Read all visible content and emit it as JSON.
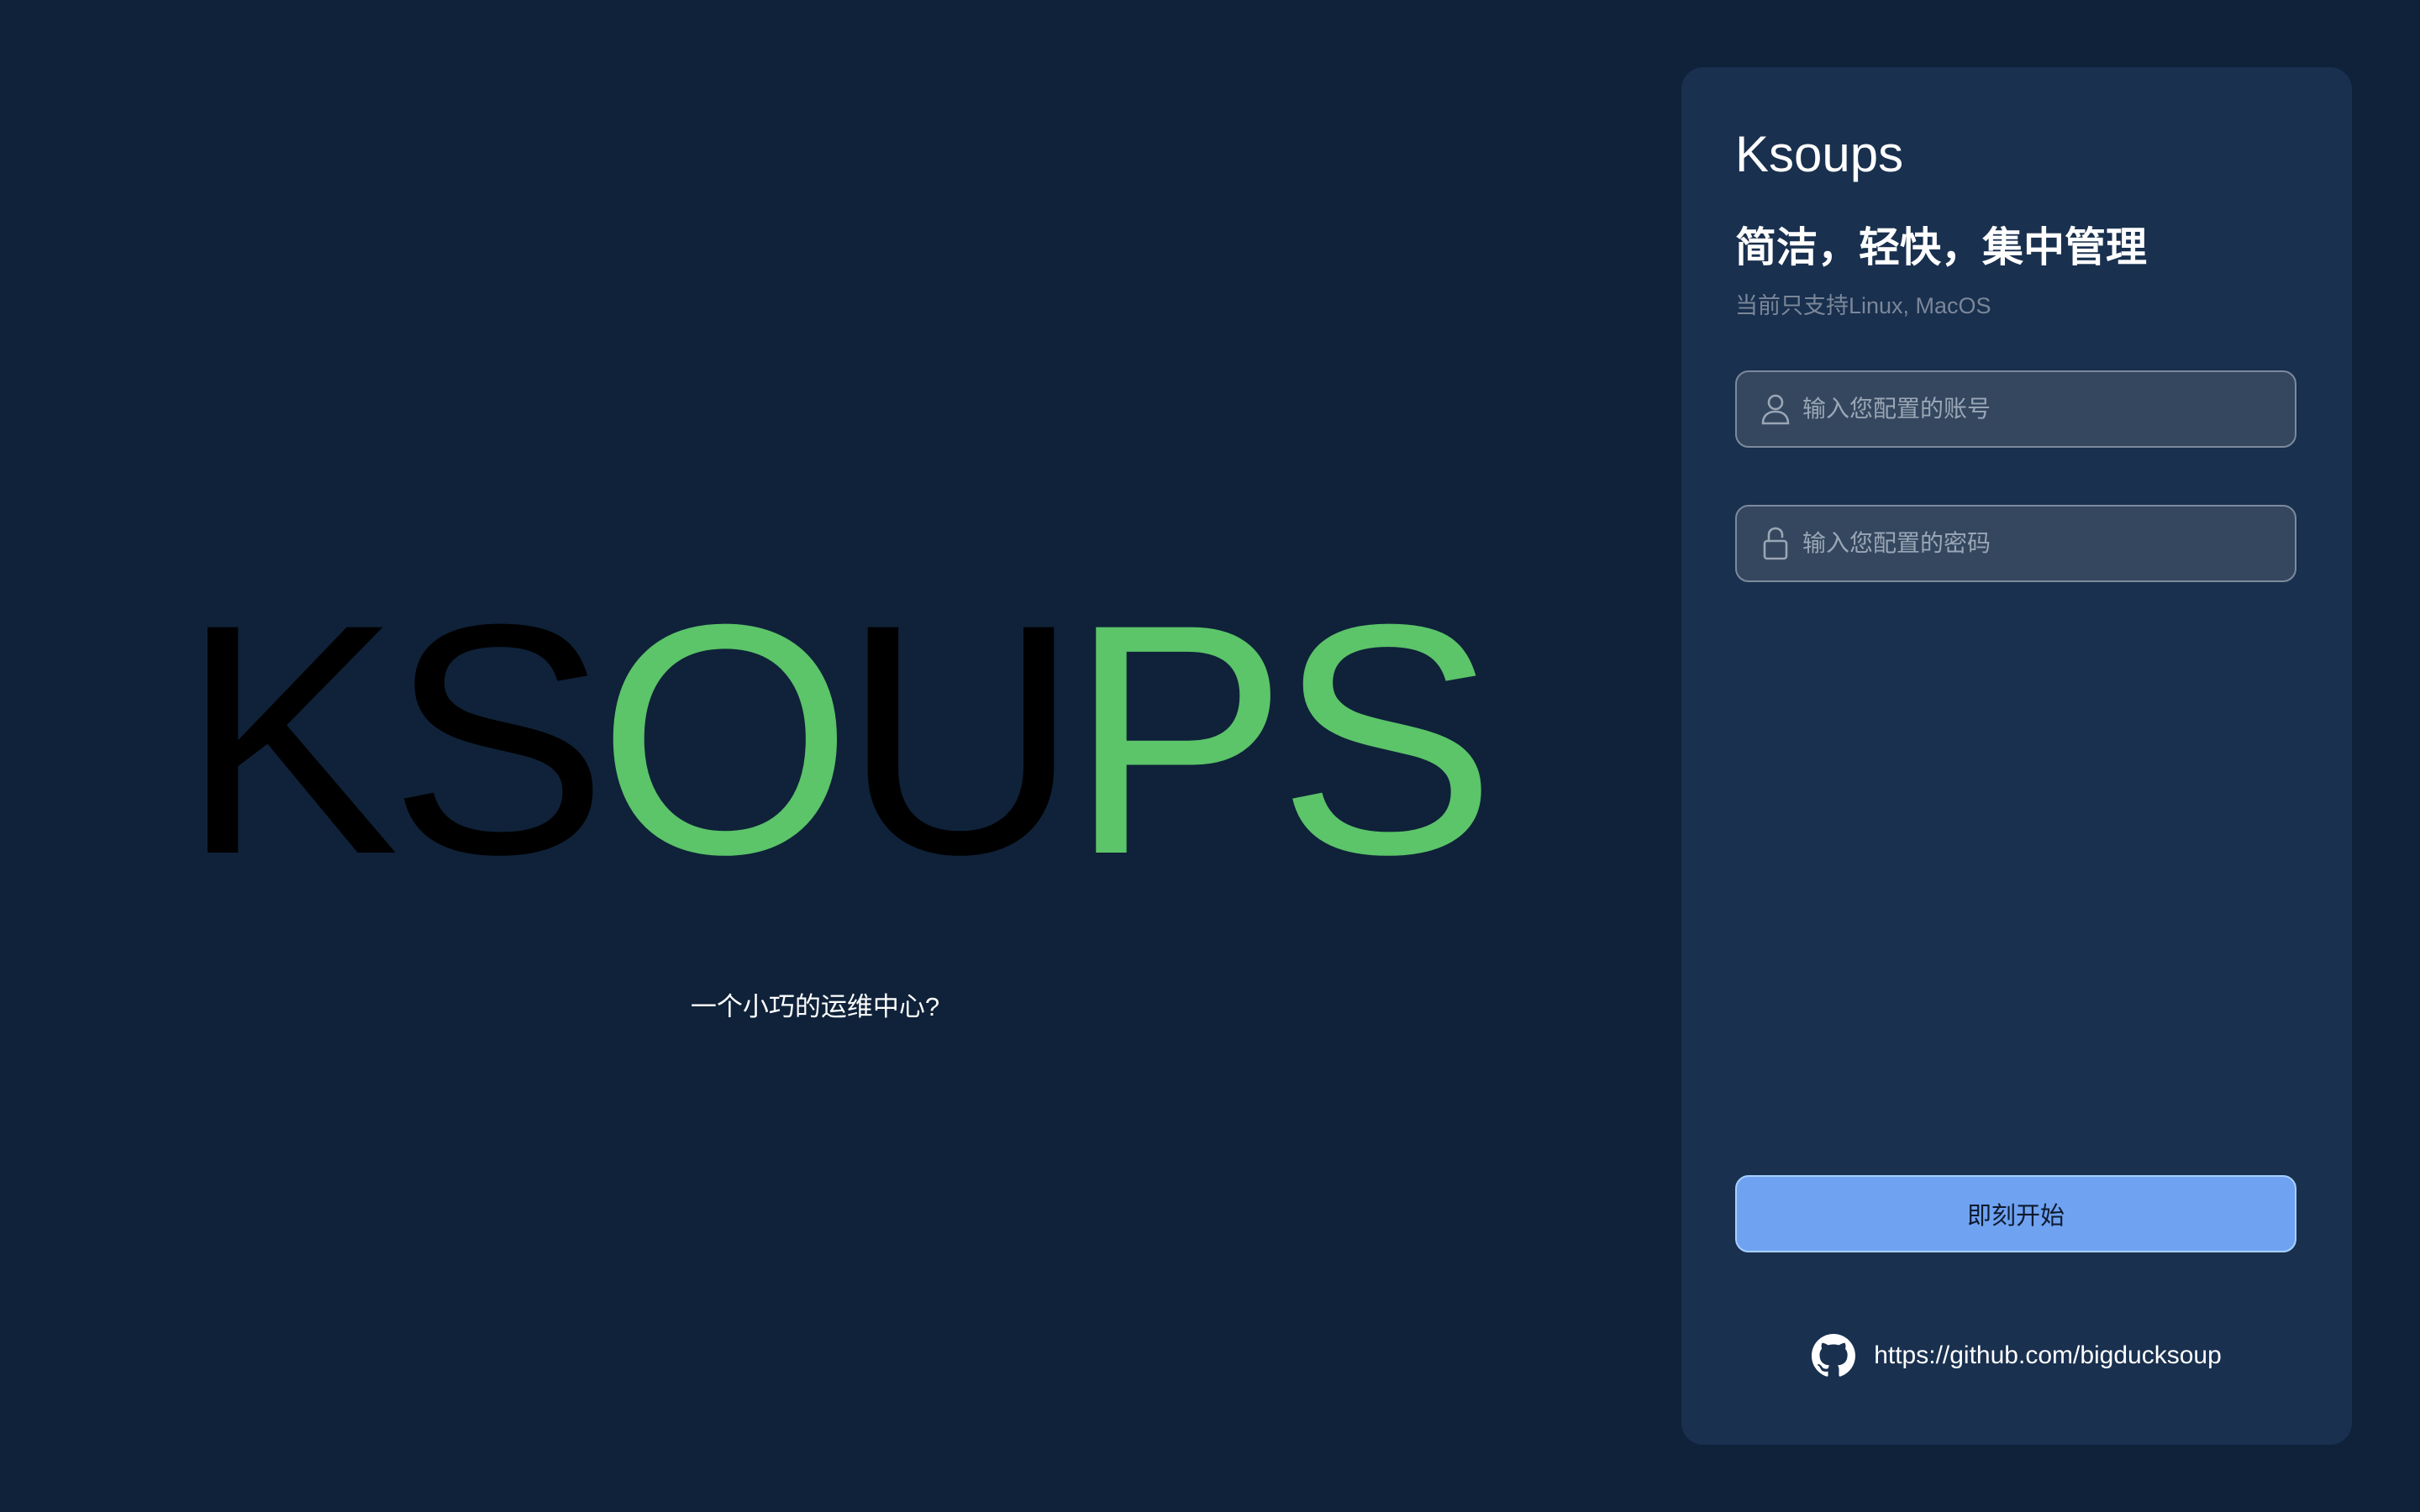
{
  "hero": {
    "logo_letters": [
      {
        "char": "K",
        "color": "#000000"
      },
      {
        "char": "S",
        "color": "#000000"
      },
      {
        "char": "O",
        "color": "#5cc469"
      },
      {
        "char": "U",
        "color": "#000000"
      },
      {
        "char": "P",
        "color": "#5cc469"
      },
      {
        "char": "S",
        "color": "#5cc469"
      }
    ],
    "tagline": "一个小巧的运维中心?"
  },
  "login": {
    "brand": "Ksoups",
    "headline": "简洁，轻快，集中管理",
    "subtext": "当前只支持Linux, MacOS",
    "username": {
      "value": "",
      "placeholder": "输入您配置的账号",
      "icon": "user-icon"
    },
    "password": {
      "value": "",
      "placeholder": "输入您配置的密码",
      "icon": "lock-icon"
    },
    "submit_label": "即刻开始",
    "github": {
      "icon": "github-icon",
      "link_text": "https://github.com/bigducksoup"
    }
  },
  "colors": {
    "background": "#0f2239",
    "card": "#19304f",
    "accent_green": "#5cc469",
    "button": "#70a2f2"
  }
}
